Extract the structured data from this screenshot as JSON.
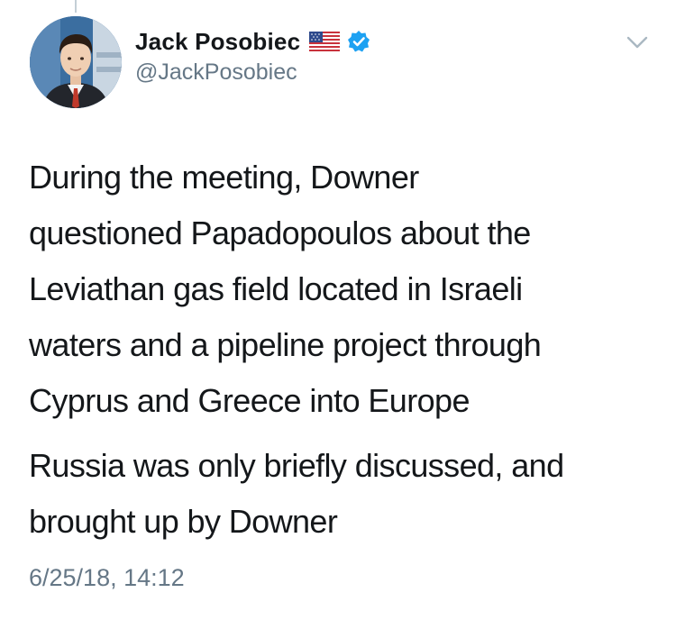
{
  "tweet": {
    "author": {
      "display_name": "Jack Posobiec",
      "handle": "@JackPosobiec",
      "flag_icon": "us-flag-icon",
      "verified_icon": "verified-badge-icon",
      "avatar_icon": "profile-photo"
    },
    "menu_icon": "chevron-down-icon",
    "paragraphs": [
      "During the meeting, Downer\nquestioned Papadopoulos about the\nLeviathan gas field located in Israeli\nwaters and a pipeline project through\nCyprus and Greece into Europe",
      "Russia was only briefly discussed, and\nbrought up by Downer"
    ],
    "timestamp": "6/25/18, 14:12"
  },
  "colors": {
    "text_primary": "#14171a",
    "text_secondary": "#657786",
    "verified_blue": "#1da1f2",
    "background": "#ffffff"
  }
}
